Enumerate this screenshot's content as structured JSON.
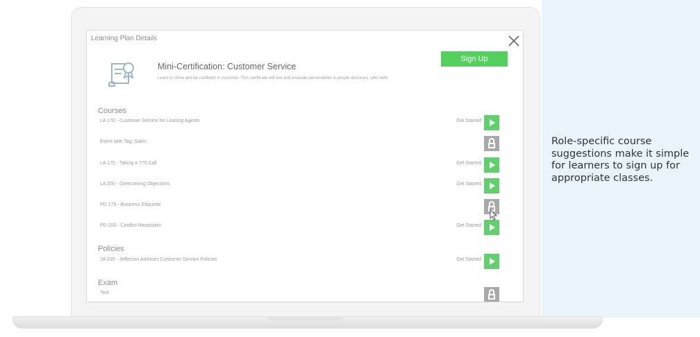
{
  "dialog": {
    "title": "Learning Plan Details",
    "close_icon": "close-icon"
  },
  "plan": {
    "icon": "certificate-scroll-icon",
    "title": "Mini-Certification: Customer Service",
    "description": "Learn to shine and be confident in customer. This certificate will test and evaluate personalities & people decisions, with skills",
    "signup_label": "Sign Up"
  },
  "sections": {
    "courses_heading": "Courses",
    "policies_heading": "Policies",
    "exam_heading": "Exam"
  },
  "courses": [
    {
      "label": "LA 170 - Customer Service for Leasing Agents",
      "status": "Get Started",
      "action": "play-icon"
    },
    {
      "label": "Event with Tag: Sales",
      "status": "",
      "action": "lock-icon"
    },
    {
      "label": "LA 175 - Taking a 770 Call",
      "status": "Get Started",
      "action": "play-icon"
    },
    {
      "label": "LA 200 - Overcoming Objections",
      "status": "Get Started",
      "action": "play-icon"
    },
    {
      "label": "PD 175 - Business Etiquette",
      "status": "",
      "action": "lock-icon"
    },
    {
      "label": "PD 200 - Conflict Resolution",
      "status": "Get Started",
      "action": "play-icon"
    }
  ],
  "policies": [
    {
      "label": "JA 205 - Jefferson Advisors Customer Service Policies",
      "status": "Get Started",
      "action": "play-icon"
    }
  ],
  "exam": [
    {
      "label": "Test",
      "status": "",
      "action": "lock-icon"
    }
  ],
  "caption": "Role-specific course suggestions make it simple for learners to sign up for appropriate classes.",
  "colors": {
    "accent_green": "#55cf5e",
    "lock_gray": "#a9a9a9",
    "side_panel": "#eaf4fb"
  }
}
